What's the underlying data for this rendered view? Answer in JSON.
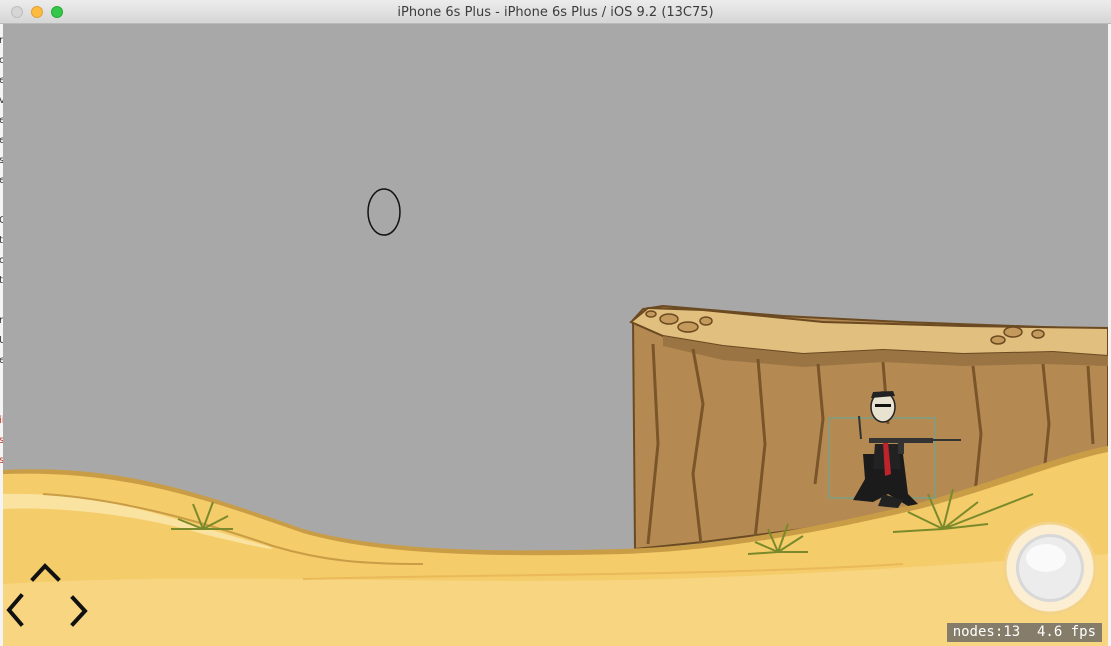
{
  "window": {
    "title": "iPhone 6s Plus - iPhone 6s Plus / iOS 9.2 (13C75)"
  },
  "left_strip_glyphs": [
    "n",
    "c",
    "e",
    "v",
    "e",
    "e",
    "s",
    "e",
    "",
    "O",
    "te",
    "o",
    "t",
    "",
    "re",
    "U",
    "e",
    "",
    "",
    "ii",
    "s",
    "s"
  ],
  "hud": {
    "stats_text": "nodes:13  4.6 fps"
  },
  "icons": {
    "dpad": "dpad-arrows-icon",
    "fire": "fire-button-icon",
    "bubble": "oval-outline-icon"
  },
  "colors": {
    "sky": "#a8a8a8",
    "sand": "#f5cc6a",
    "sand_light": "#fae3a0",
    "cliff": "#b48a52",
    "cliff_top": "#e1bf7f"
  }
}
